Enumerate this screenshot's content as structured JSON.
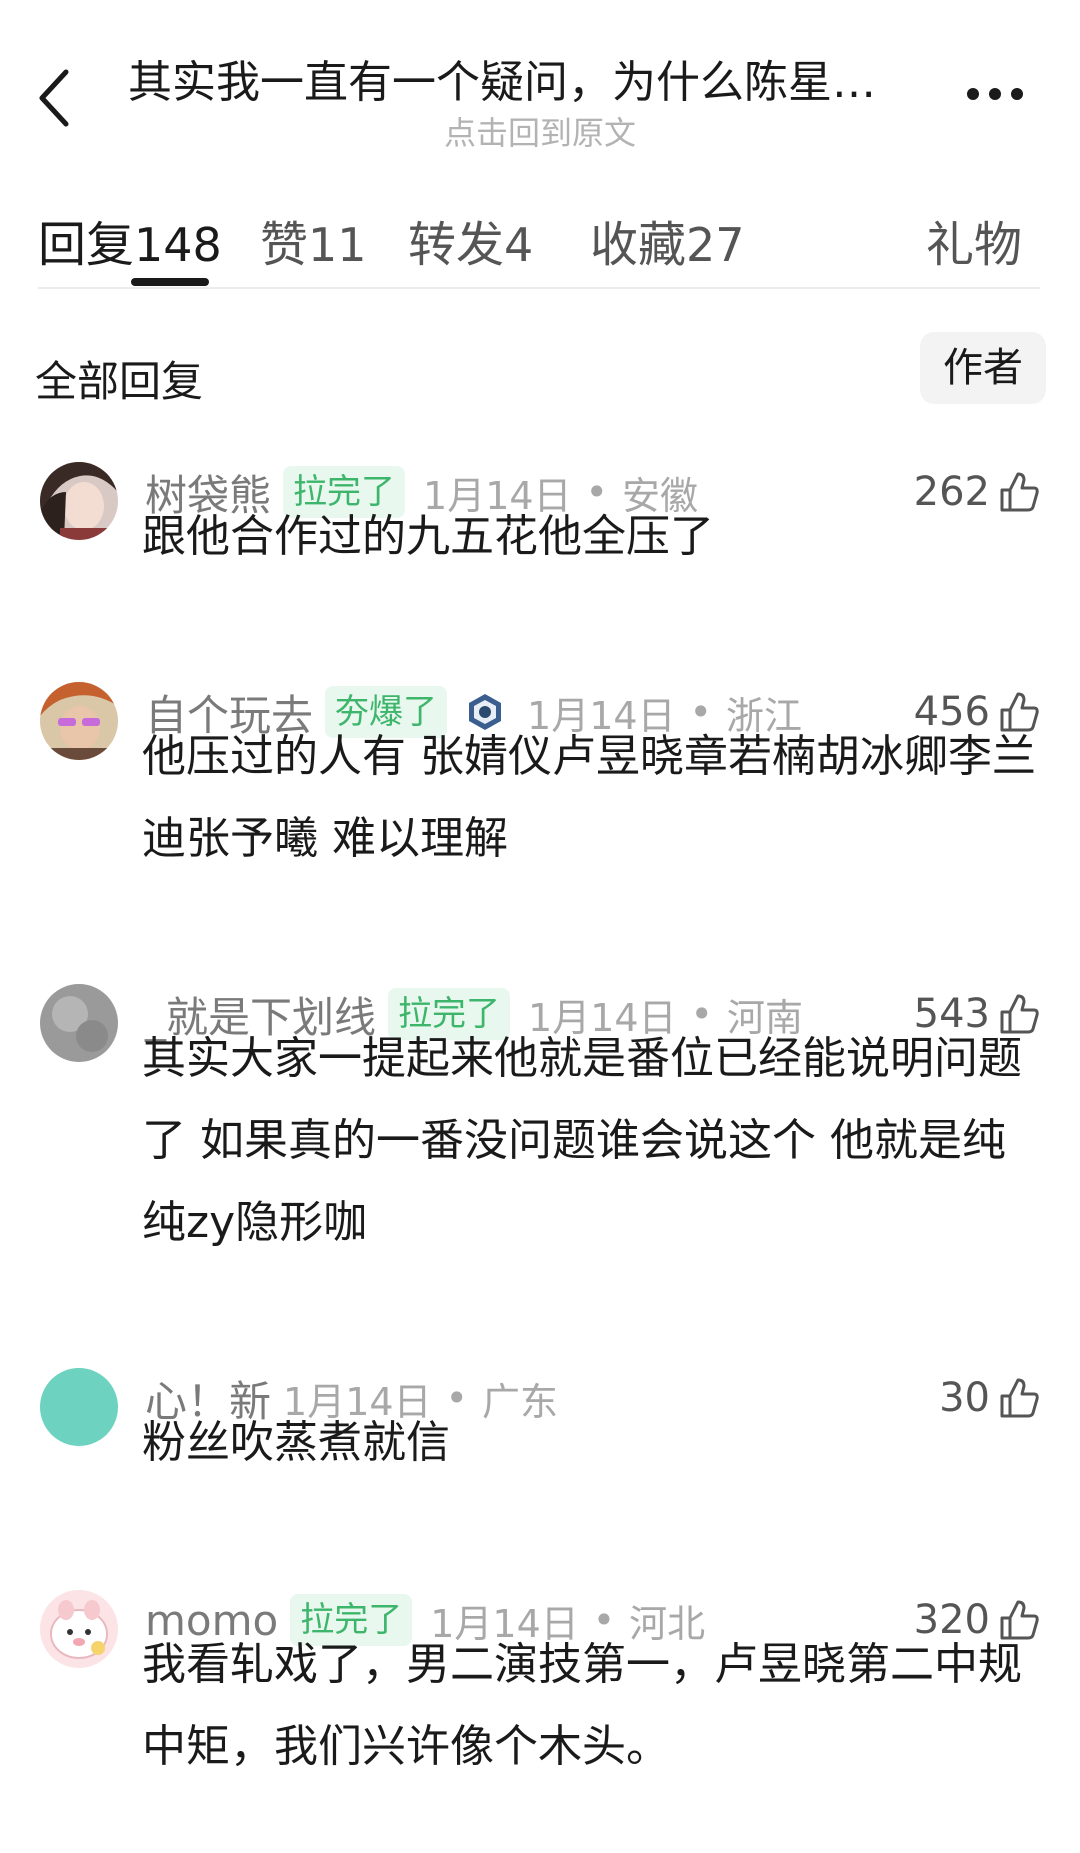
{
  "header": {
    "title": "其实我一直有一个疑问，为什么陈星…",
    "subtitle": "点击回到原文"
  },
  "tabs": [
    {
      "label": "回复",
      "count": "148"
    },
    {
      "label": "赞",
      "count": "11"
    },
    {
      "label": "转发",
      "count": "4"
    },
    {
      "label": "收藏",
      "count": "27"
    },
    {
      "label": "礼物",
      "count": ""
    }
  ],
  "section": {
    "title": "全部回复",
    "author_button": "作者"
  },
  "comments": [
    {
      "username": "树袋熊",
      "badge": "拉完了",
      "date": "1月14日",
      "region": "安徽",
      "likes": "262",
      "text": "跟他合作过的九五花他全压了"
    },
    {
      "username": "自个玩去",
      "badge": "夯爆了",
      "date": "1月14日",
      "region": "浙江",
      "likes": "456",
      "text": "他压过的人有 张婧仪卢昱晓章若楠胡冰卿李兰迪张予曦 难以理解"
    },
    {
      "username": "_就是下划线",
      "badge": "拉完了",
      "date": "1月14日",
      "region": "河南",
      "likes": "543",
      "text": "其实大家一提起来他就是番位已经能说明问题了 如果真的一番没问题谁会说这个 他就是纯纯zy隐形咖"
    },
    {
      "username": "心！新",
      "badge": "",
      "date": "1月14日",
      "region": "广东",
      "likes": "30",
      "text": "粉丝吹蒸煮就信"
    },
    {
      "username": "momo",
      "badge": "拉完了",
      "date": "1月14日",
      "region": "河北",
      "likes": "320",
      "text": "我看轧戏了，男二演技第一，卢昱晓第二中规中矩，我们兴许像个木头。"
    }
  ],
  "separator": "•"
}
